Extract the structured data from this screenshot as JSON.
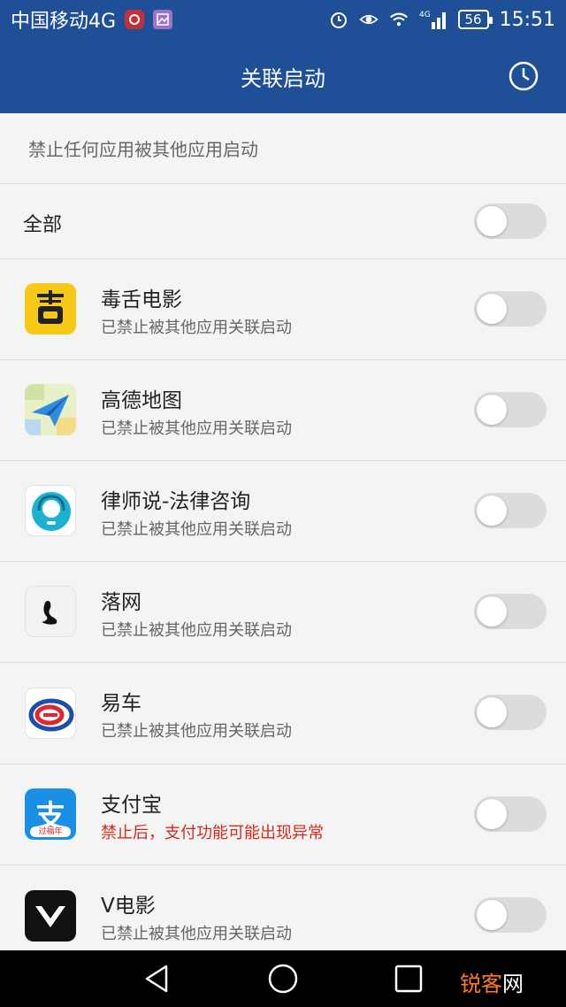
{
  "statusbar": {
    "carrier": "中国移动4G",
    "network": "4G",
    "battery": "56",
    "time": "15:51"
  },
  "appbar": {
    "title": "关联启动"
  },
  "description": "禁止任何应用被其他应用启动",
  "all_toggle": {
    "label": "全部",
    "enabled": false
  },
  "apps": [
    {
      "name": "毒舌电影",
      "status": "已禁止被其他应用关联启动",
      "warn": false,
      "enabled": false,
      "icon": "dushe-icon"
    },
    {
      "name": "高德地图",
      "status": "已禁止被其他应用关联启动",
      "warn": false,
      "enabled": false,
      "icon": "amap-icon"
    },
    {
      "name": "律师说-法律咨询",
      "status": "已禁止被其他应用关联启动",
      "warn": false,
      "enabled": false,
      "icon": "lawyer-icon"
    },
    {
      "name": "落网",
      "status": "已禁止被其他应用关联启动",
      "warn": false,
      "enabled": false,
      "icon": "luowang-icon"
    },
    {
      "name": "易车",
      "status": "已禁止被其他应用关联启动",
      "warn": false,
      "enabled": false,
      "icon": "yiche-icon"
    },
    {
      "name": "支付宝",
      "status": "禁止后，支付功能可能出现异常",
      "warn": true,
      "enabled": false,
      "icon": "alipay-icon",
      "icon_text": "支",
      "icon_badge": "过福年"
    },
    {
      "name": "V电影",
      "status": "已禁止被其他应用关联启动",
      "warn": false,
      "enabled": false,
      "icon": "vmovie-icon"
    }
  ],
  "watermark": {
    "part1": "锐客",
    "part2": "网"
  },
  "colors": {
    "primary": "#1f4f96",
    "warning": "#d8281c",
    "toggle_off": "#dcdcdc"
  }
}
